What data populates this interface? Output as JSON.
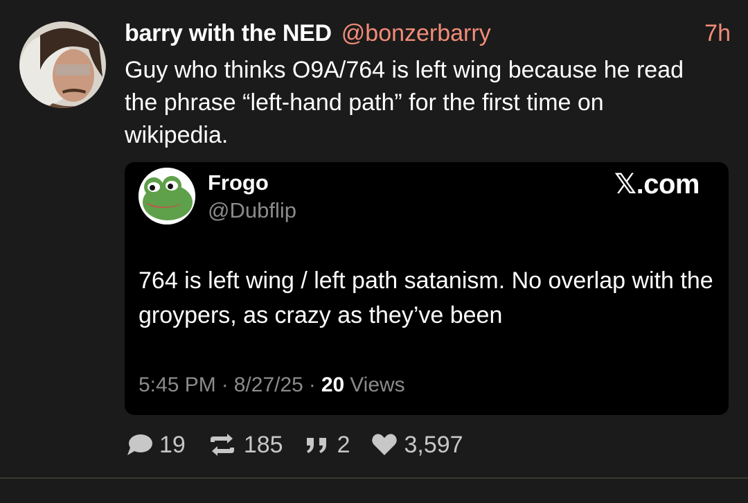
{
  "post": {
    "author_name": "barry with the NED",
    "author_handle": "@bonzerbarry",
    "time_ago": "7h",
    "body": "Guy who thinks O9A/764 is left wing because he read\nthe phrase “left-hand path” for the first time on\nwikipedia.",
    "avatar_icon": "user-photo-avatar"
  },
  "quote": {
    "name": "Frogo",
    "handle": "@Dubflip",
    "source_label": "𝕏.com",
    "text": "764 is left wing / left path satanism.  No overlap with the groypers, as crazy as they’ve been",
    "time": "5:45 PM",
    "separator": "·",
    "date": "8/27/25",
    "views_count": "20",
    "views_label": "Views",
    "avatar_icon": "frog-avatar"
  },
  "stats": {
    "replies": "19",
    "reposts": "185",
    "quotes": "2",
    "likes": "3,597"
  },
  "colors": {
    "background": "#1b1b1b",
    "accent": "#f28c78",
    "card": "#000000",
    "muted": "#8b8b8b"
  }
}
